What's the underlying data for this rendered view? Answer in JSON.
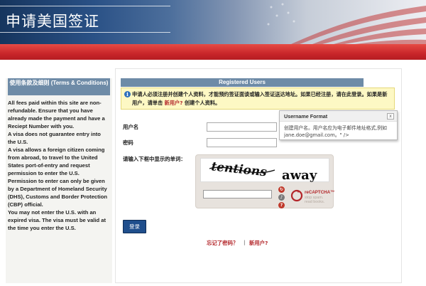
{
  "header": {
    "title": "申请美国签证"
  },
  "sidebar": {
    "heading": "使用条款及细则 (Terms & Conditions)",
    "body": "All fees paid within this site are non-refundable. Ensure that you have already made the payment and have a Reciept Number with you.\nA visa does not guarantee entry into the U.S.\nA visa allows a foreign citizen coming from abroad, to travel to the United States port-of-entry and request permission to enter the U.S.\nPermission to enter can only be given by a Department of Homeland Security (DHS), Customs and Border Protection (CBP) official.\nYou may not enter the U.S. with an expired visa. The visa must be valid at the time you enter the U.S."
  },
  "login": {
    "section_title": "Registered Users",
    "notice_text": "申请人必须注册并创建个人资料，才能预约签证面谈或输入签证送达地址。如果已经注册，请在此登录。如果是新用户，请单击",
    "notice_link": "新用户?",
    "notice_suffix": "创建个人资料。",
    "username_label": "用户名",
    "password_label": "密码",
    "captcha_label": "请输入下框中显示的单词：",
    "captcha_word1": "tentions",
    "captcha_word2": "away",
    "recaptcha_brand": "reCAPTCHA™",
    "recaptcha_tag1": "stop spam.",
    "recaptcha_tag2": "read books.",
    "login_button": "登录",
    "forgot_link": "忘记了密码？",
    "separator": "|",
    "new_user_link": "新用户?"
  },
  "tooltip": {
    "title": "Username Format",
    "close_label": "x",
    "body": "创建用户名。用户名应为电子邮件地址格式,例如 jane.doe@gmail.com。\" />"
  },
  "colors": {
    "red_bar": "#c9262a",
    "section_header": "#6e8ba7",
    "notice_bg": "#fdf8c4",
    "link_red": "#b3262a",
    "button_blue": "#1f4e8c"
  }
}
